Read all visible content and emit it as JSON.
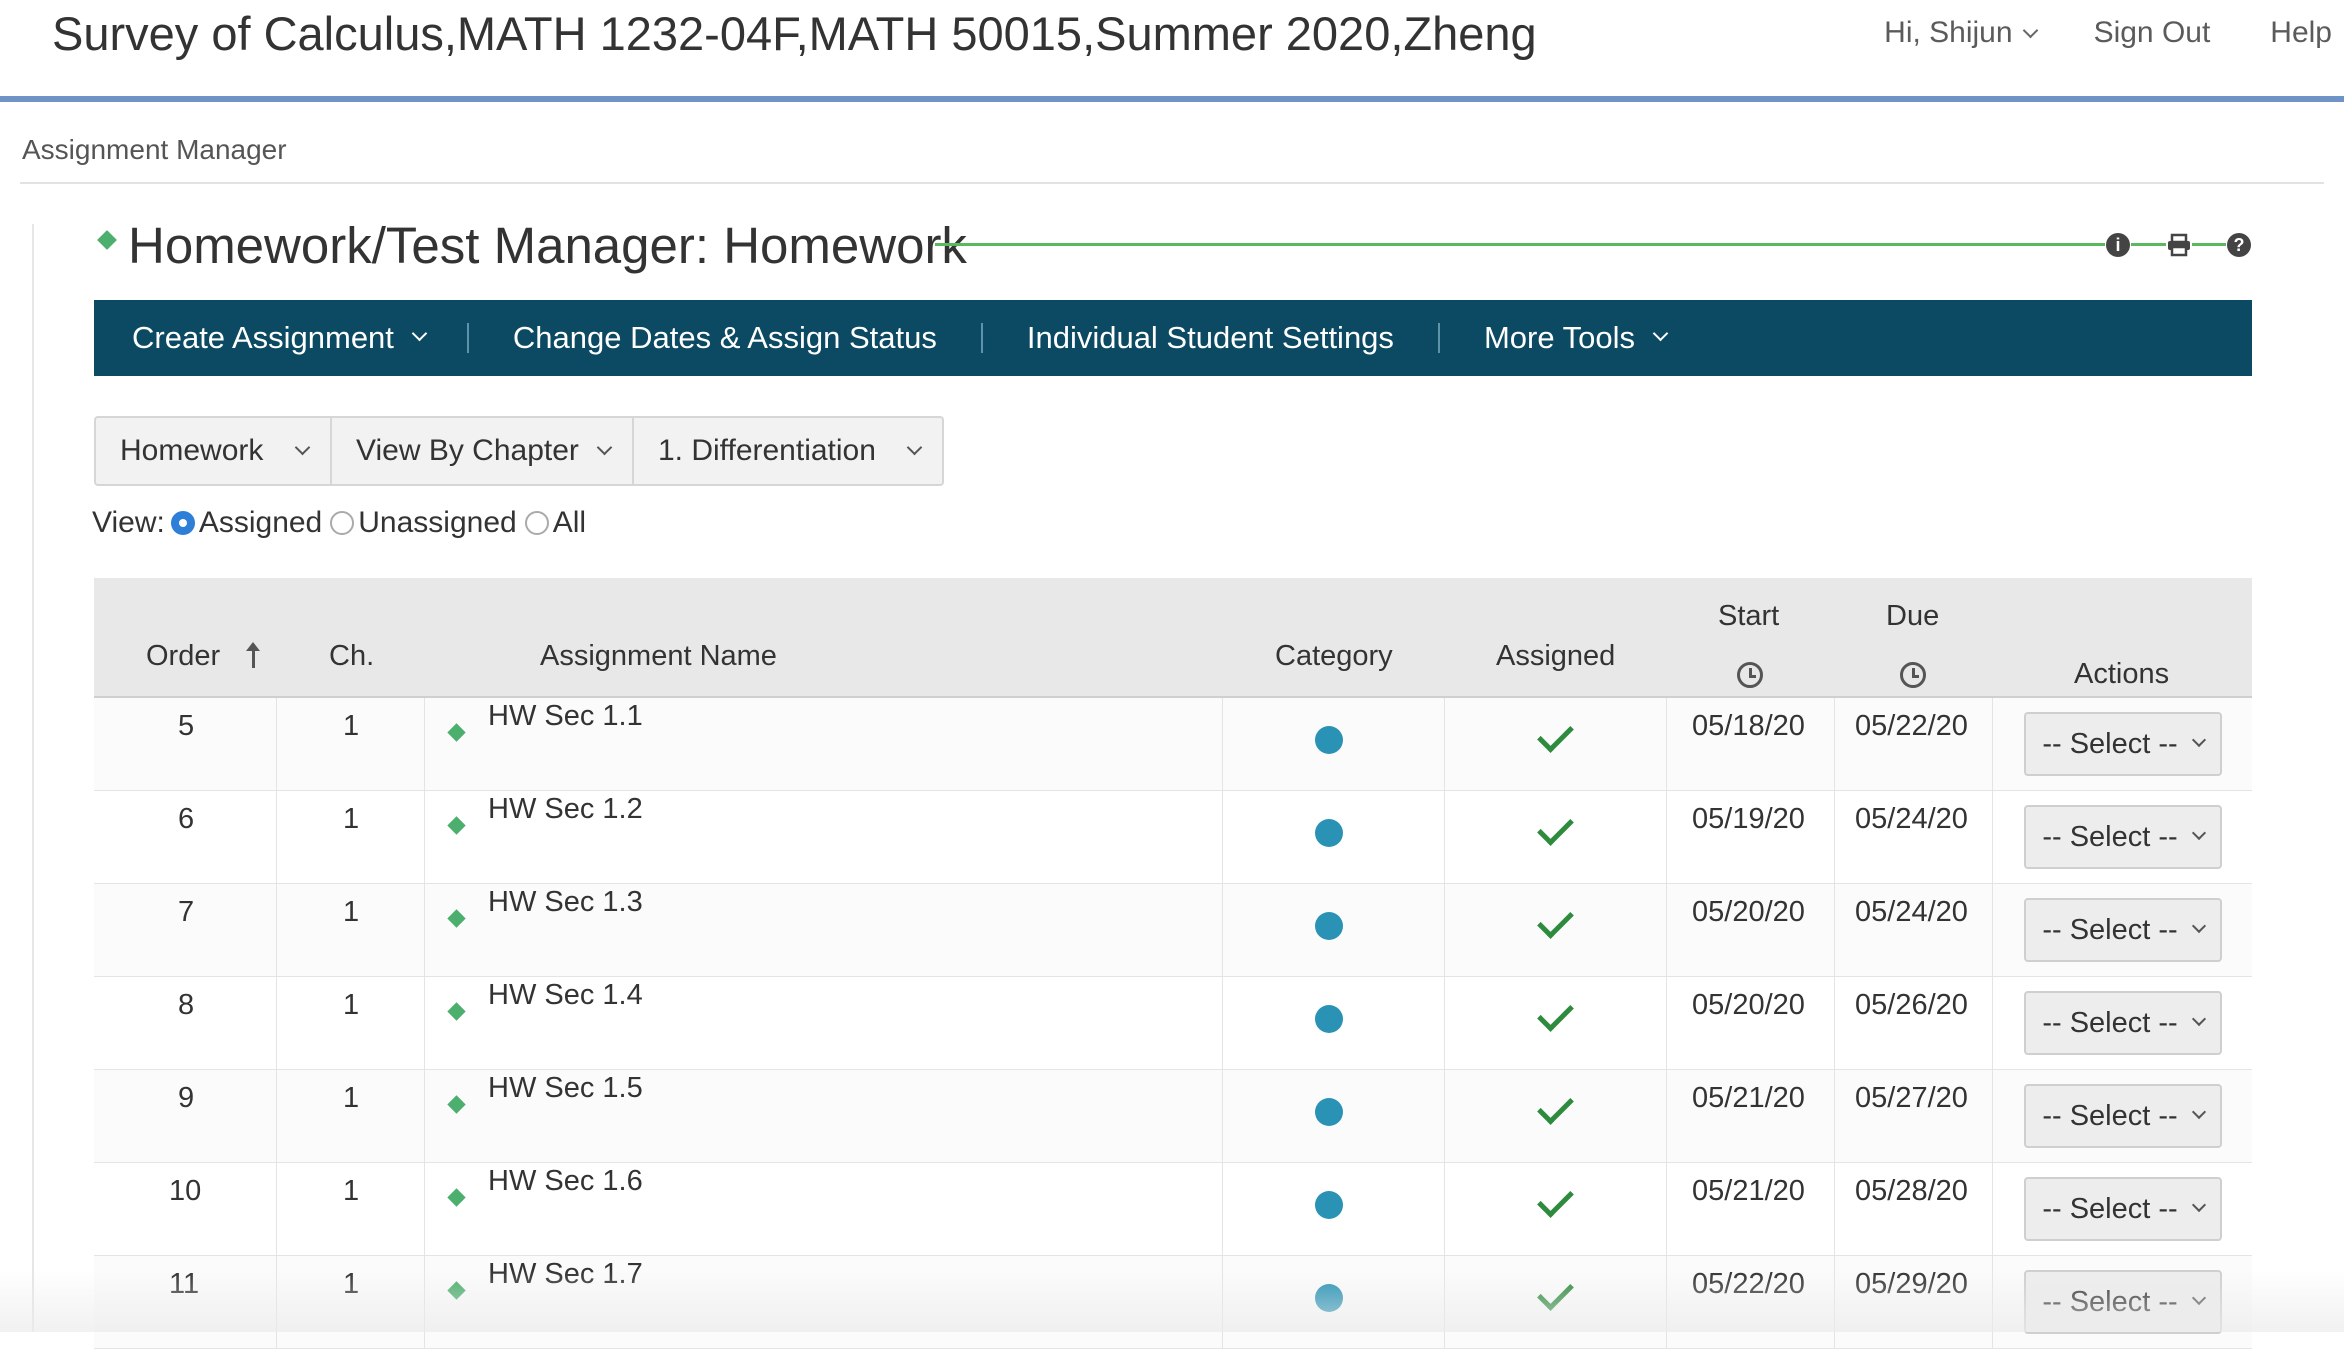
{
  "header": {
    "course_title": "Survey of Calculus,MATH 1232-04F,MATH 50015,Summer 2020,Zheng",
    "greeting": "Hi, Shijun",
    "sign_out": "Sign Out",
    "help": "Help"
  },
  "breadcrumb": "Assignment Manager",
  "page_heading": "Homework/Test Manager: Homework",
  "heading_icons": [
    "info-icon",
    "print-icon",
    "help-icon"
  ],
  "toolbar": {
    "create_assignment": "Create Assignment",
    "change_dates": "Change Dates & Assign Status",
    "individual_settings": "Individual Student Settings",
    "more_tools": "More Tools"
  },
  "filters": {
    "type": "Homework",
    "view_by": "View By Chapter",
    "chapter": "1. Differentiation"
  },
  "view": {
    "label": "View:",
    "options": [
      "Assigned",
      "Unassigned",
      "All"
    ],
    "selected": "Assigned"
  },
  "table": {
    "headers": {
      "order": "Order",
      "chapter": "Ch.",
      "name": "Assignment Name",
      "category": "Category",
      "assigned": "Assigned",
      "start": "Start",
      "due": "Due",
      "actions": "Actions"
    },
    "rows": [
      {
        "order": "5",
        "ch": "1",
        "name": "HW Sec 1.1",
        "start": "05/18/20",
        "due": "05/22/20",
        "action": "-- Select --"
      },
      {
        "order": "6",
        "ch": "1",
        "name": "HW Sec 1.2",
        "start": "05/19/20",
        "due": "05/24/20",
        "action": "-- Select --"
      },
      {
        "order": "7",
        "ch": "1",
        "name": "HW Sec 1.3",
        "start": "05/20/20",
        "due": "05/24/20",
        "action": "-- Select --"
      },
      {
        "order": "8",
        "ch": "1",
        "name": "HW Sec 1.4",
        "start": "05/20/20",
        "due": "05/26/20",
        "action": "-- Select --"
      },
      {
        "order": "9",
        "ch": "1",
        "name": "HW Sec 1.5",
        "start": "05/21/20",
        "due": "05/27/20",
        "action": "-- Select --"
      },
      {
        "order": "10",
        "ch": "1",
        "name": "HW Sec 1.6",
        "start": "05/21/20",
        "due": "05/28/20",
        "action": "-- Select --"
      },
      {
        "order": "11",
        "ch": "1",
        "name": "HW Sec 1.7",
        "start": "05/22/20",
        "due": "05/29/20",
        "action": "-- Select --"
      }
    ]
  },
  "colors": {
    "toolbar_bg": "#0b4a62",
    "header_rule": "#6e93c6",
    "accent_green": "#4caf6e",
    "category_dot": "#2a93b5",
    "check_green": "#2e8b3e"
  }
}
